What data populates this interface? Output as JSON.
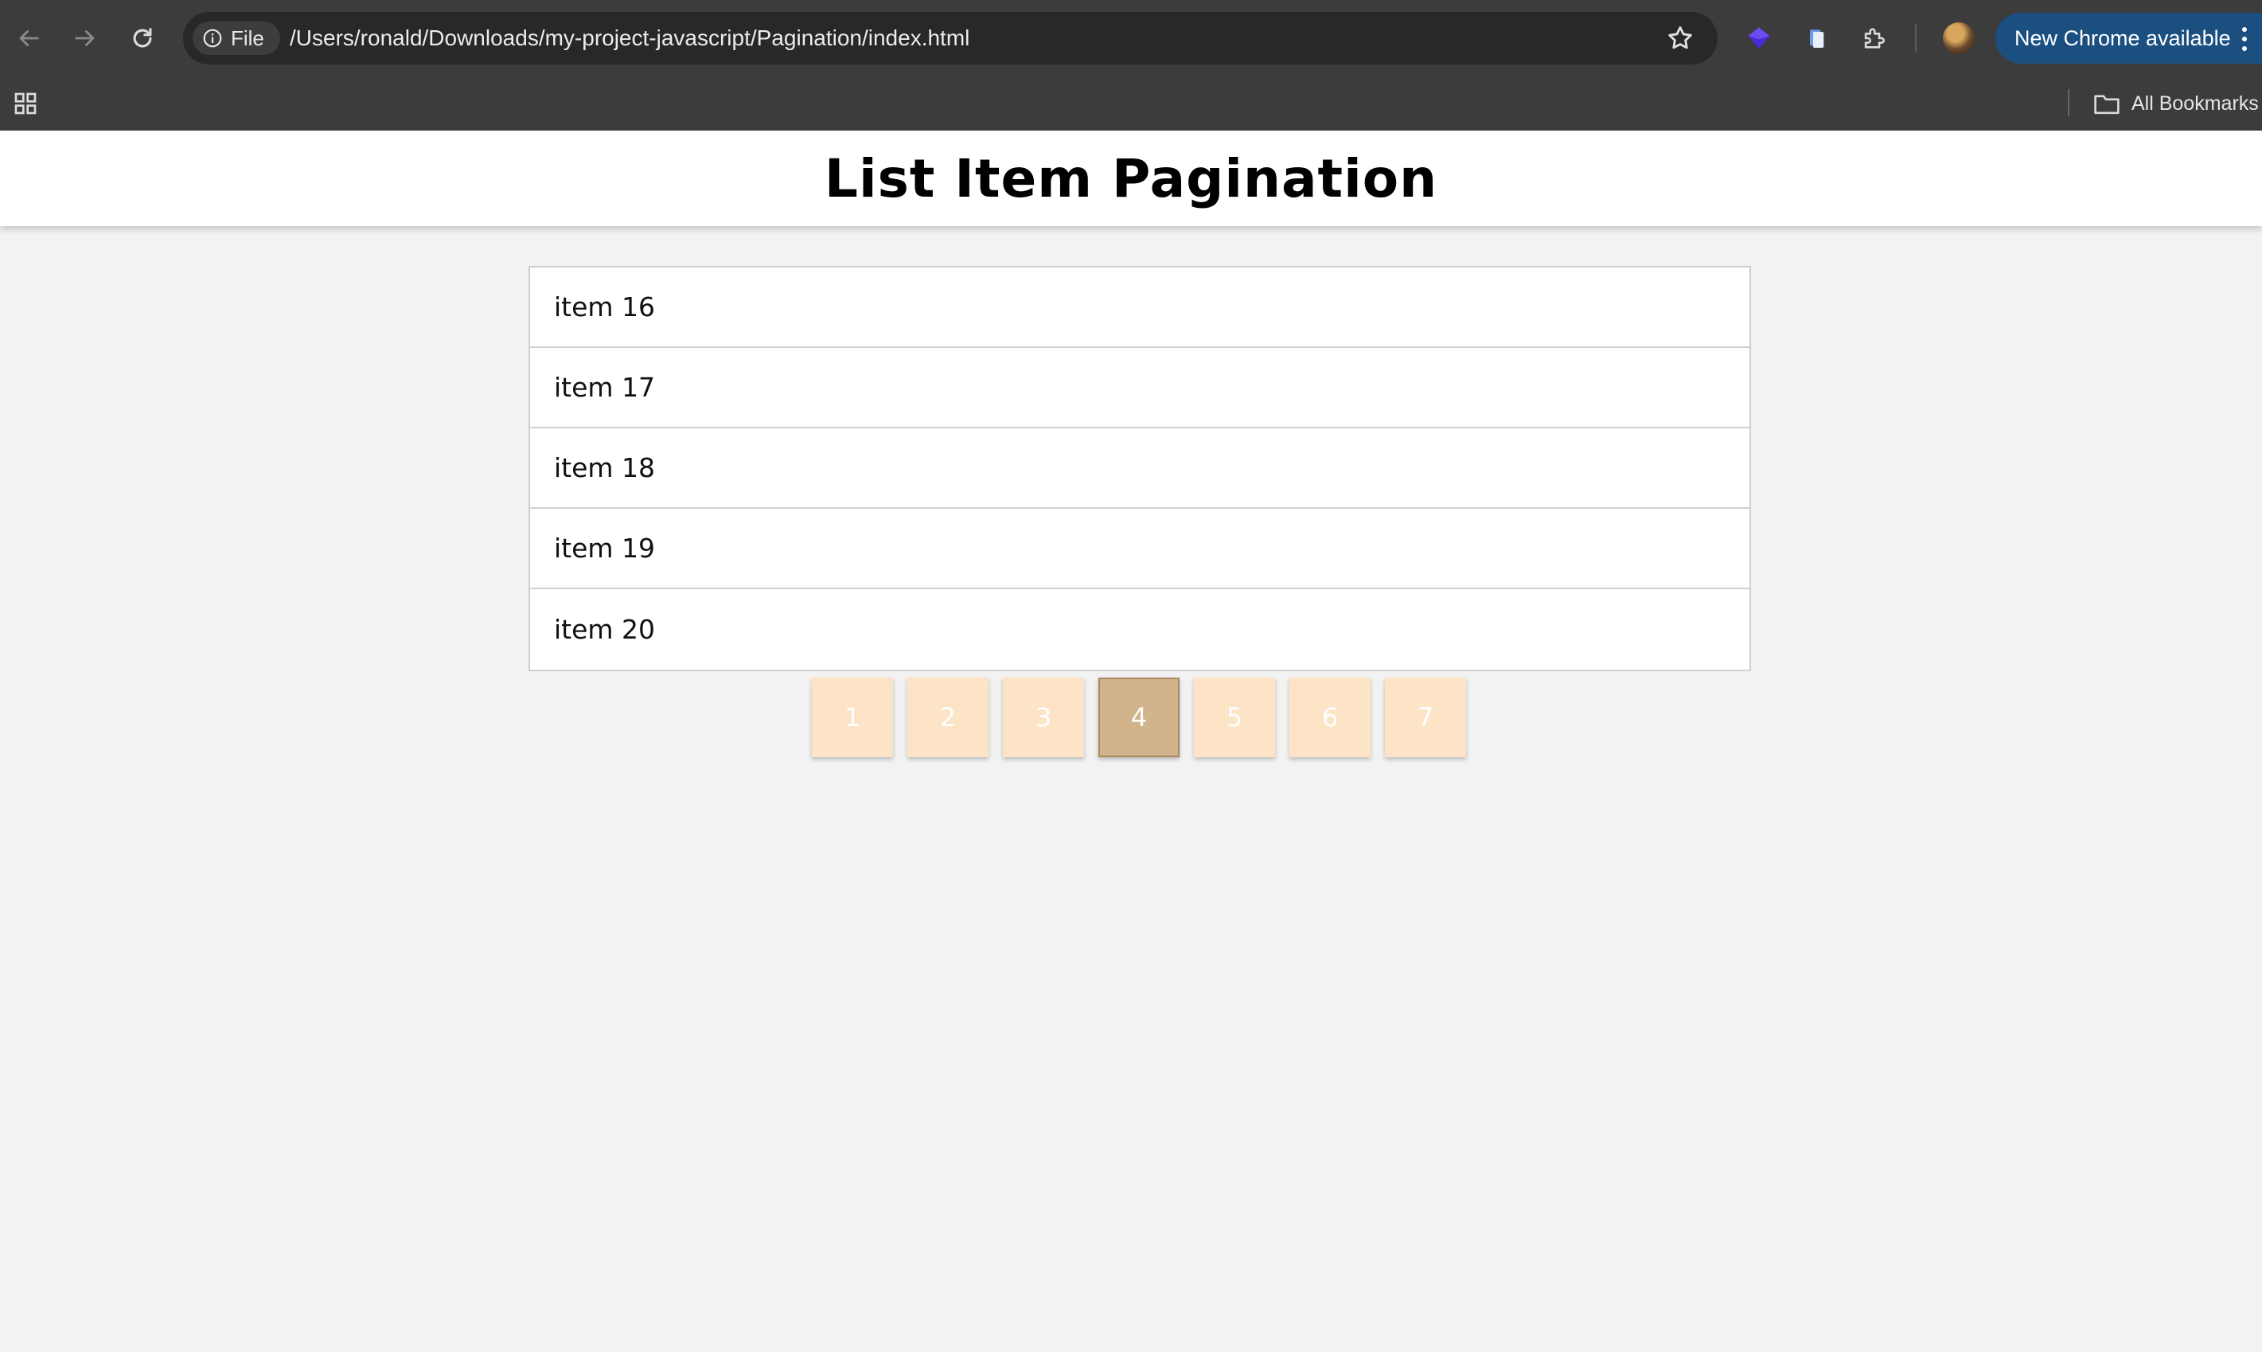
{
  "browser": {
    "url_scheme_label": "File",
    "url": "/Users/ronald/Downloads/my-project-javascript/Pagination/index.html",
    "update_button_label": "New Chrome available",
    "all_bookmarks_label": "All Bookmarks"
  },
  "page": {
    "title": "List Item Pagination",
    "items": [
      "item 16",
      "item 17",
      "item 18",
      "item 19",
      "item 20"
    ],
    "pages": [
      "1",
      "2",
      "3",
      "4",
      "5",
      "6",
      "7"
    ],
    "active_page": "4"
  },
  "colors": {
    "page_button": "#fde4c7",
    "page_button_active": "#d2b48c",
    "update_button": "#1b4f80"
  }
}
